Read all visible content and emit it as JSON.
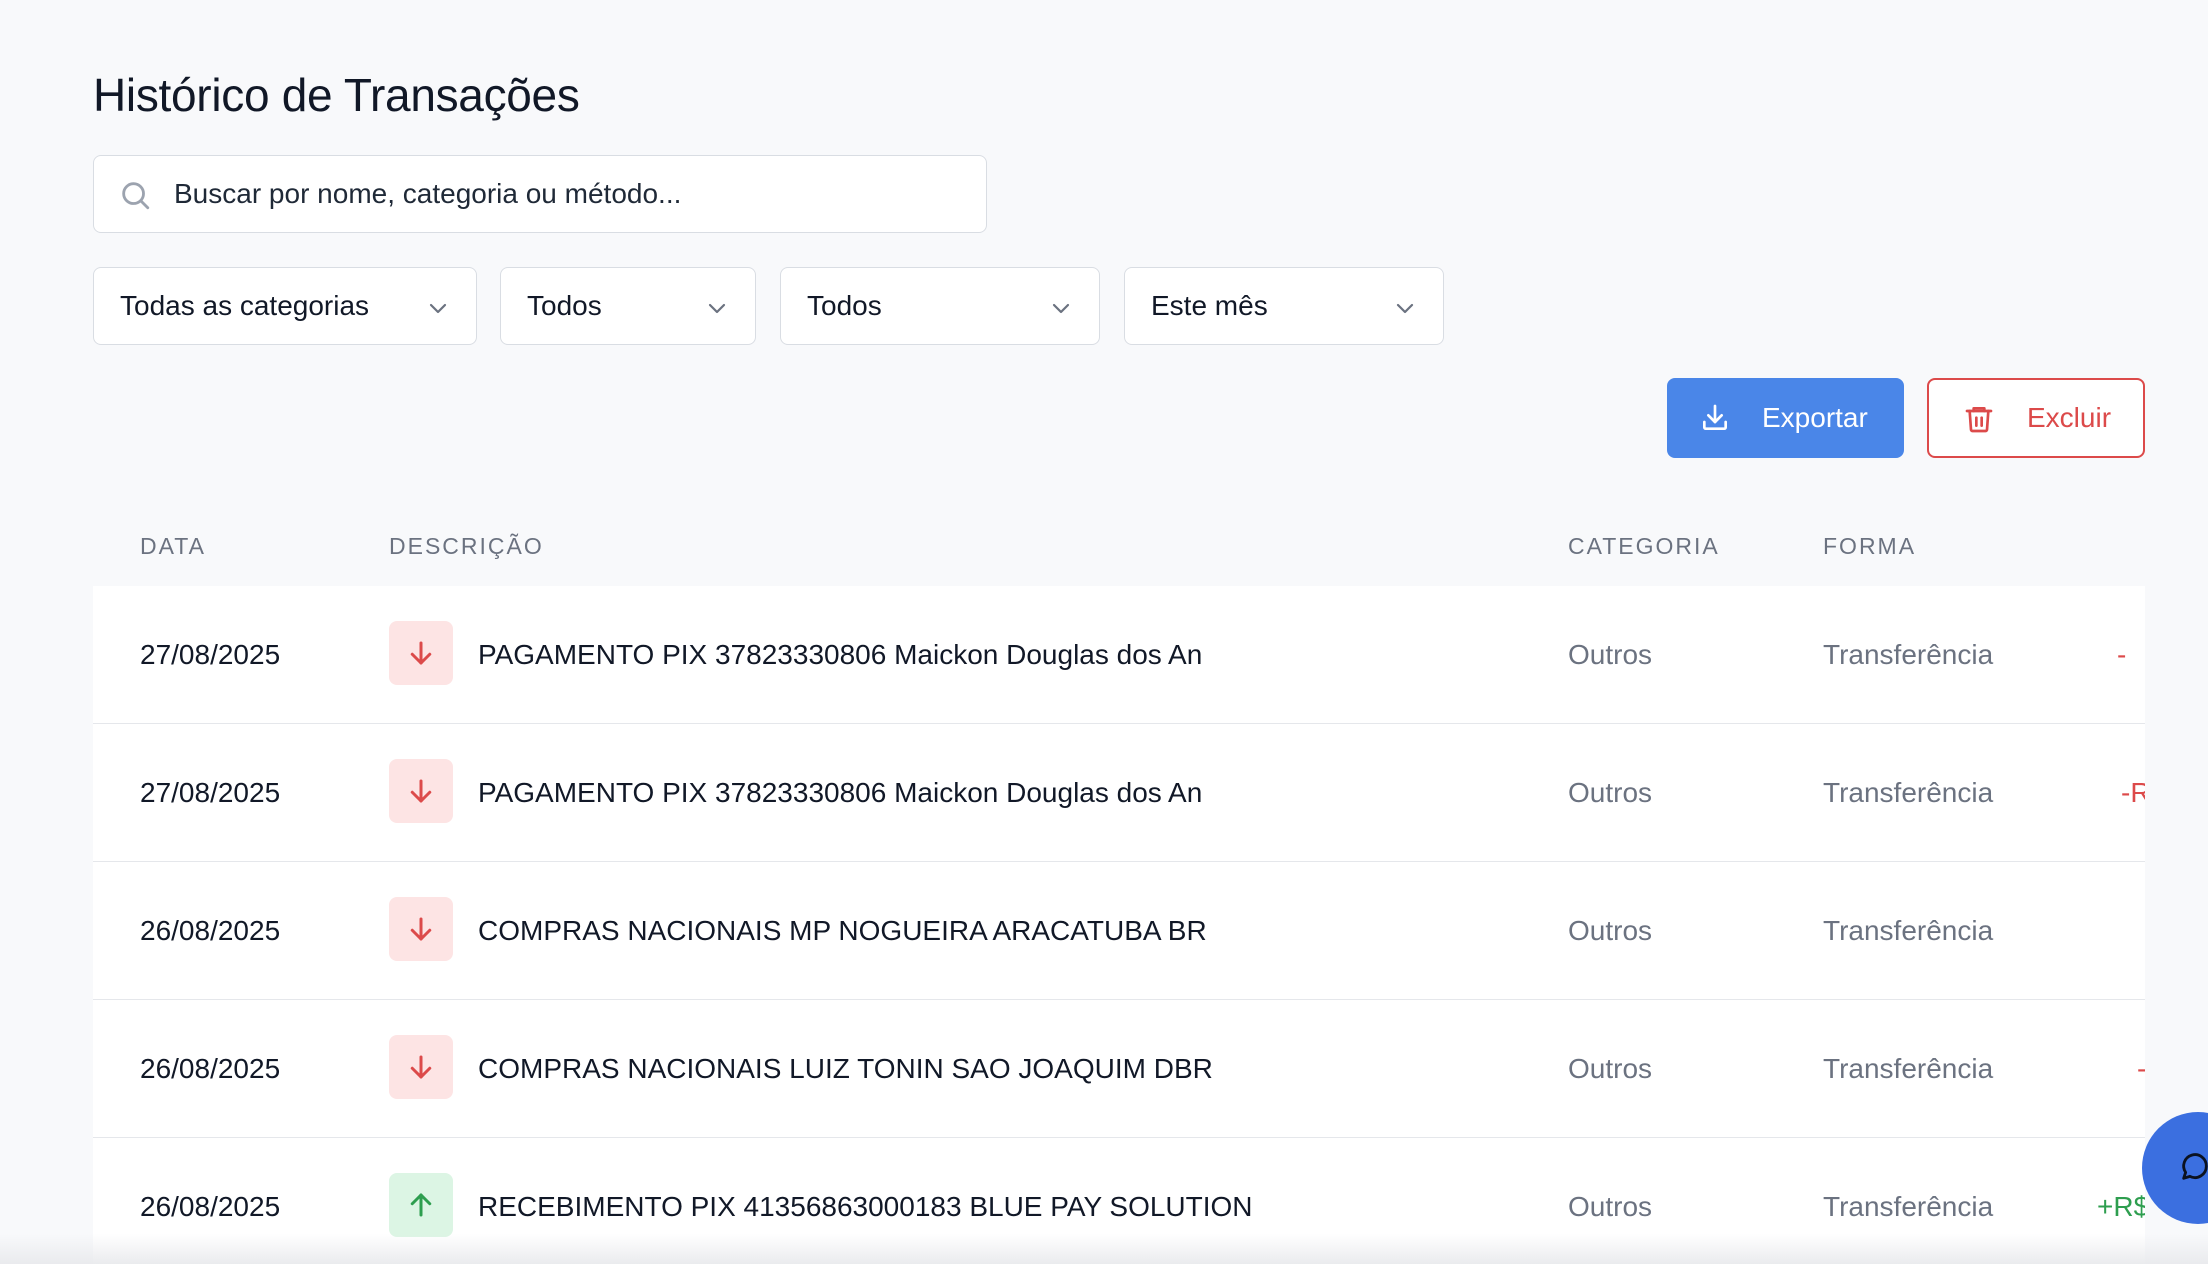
{
  "page": {
    "title": "Histórico de Transações"
  },
  "search": {
    "value": "Buscar por nome, categoria ou método..."
  },
  "filters": [
    {
      "value": "Todas as categorias"
    },
    {
      "value": "Todos"
    },
    {
      "value": "Todos"
    },
    {
      "value": "Este mês"
    }
  ],
  "actions": {
    "export_label": "Exportar",
    "delete_label": "Excluir"
  },
  "table": {
    "headers": [
      "DATA",
      "DESCRIÇÃO",
      "CATEGORIA",
      "FORMA"
    ],
    "rows": [
      {
        "date": "27/08/2025",
        "direction": "out",
        "icon": "arrow-down-icon",
        "description": "PAGAMENTO PIX 37823330806 Maickon Douglas dos An",
        "category": "Outros",
        "method": "Transferência",
        "amount": "-"
      },
      {
        "date": "27/08/2025",
        "direction": "out",
        "icon": "arrow-down-icon",
        "description": "PAGAMENTO PIX 37823330806 Maickon Douglas dos An",
        "category": "Outros",
        "method": "Transferência",
        "amount": "-R"
      },
      {
        "date": "26/08/2025",
        "direction": "out",
        "icon": "arrow-down-icon",
        "description": "COMPRAS NACIONAIS MP NOGUEIRA ARACATUBA BR",
        "category": "Outros",
        "method": "Transferência",
        "amount": ""
      },
      {
        "date": "26/08/2025",
        "direction": "out",
        "icon": "arrow-down-icon",
        "description": "COMPRAS NACIONAIS LUIZ TONIN SAO JOAQUIM DBR",
        "category": "Outros",
        "method": "Transferência",
        "amount": "-"
      },
      {
        "date": "26/08/2025",
        "direction": "in",
        "icon": "arrow-up-icon",
        "description": "RECEBIMENTO PIX 41356863000183 BLUE PAY SOLUTION",
        "category": "Outros",
        "method": "Transferência",
        "amount": "+R$"
      }
    ]
  },
  "colors": {
    "accent": "#4a86e8",
    "danger": "#dc4a4a",
    "success": "#2e9e4f",
    "chat": "#3b6fe0"
  },
  "icons": {
    "search": "search-icon",
    "chevron": "chevron-down-icon",
    "export": "download-icon",
    "delete": "trash-icon",
    "chat": "chat-bubble-icon"
  }
}
